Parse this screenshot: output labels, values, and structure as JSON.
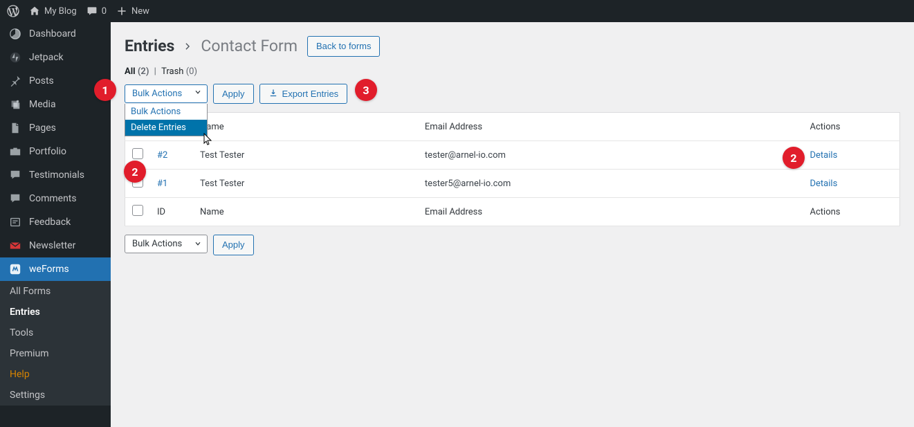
{
  "topbar": {
    "site_name": "My Blog",
    "comments_count": "0",
    "new_label": "New"
  },
  "sidebar": {
    "items": [
      {
        "label": "Dashboard",
        "icon": "dashboard"
      },
      {
        "label": "Jetpack",
        "icon": "jetpack"
      },
      {
        "label": "Posts",
        "icon": "posts"
      },
      {
        "label": "Media",
        "icon": "media"
      },
      {
        "label": "Pages",
        "icon": "pages"
      },
      {
        "label": "Portfolio",
        "icon": "portfolio"
      },
      {
        "label": "Testimonials",
        "icon": "testimonial"
      },
      {
        "label": "Comments",
        "icon": "comments"
      },
      {
        "label": "Feedback",
        "icon": "feedback"
      },
      {
        "label": "Newsletter",
        "icon": "newsletter"
      },
      {
        "label": "weForms",
        "icon": "weforms"
      }
    ],
    "submenu": [
      {
        "label": "All Forms"
      },
      {
        "label": "Entries",
        "current": true
      },
      {
        "label": "Tools"
      },
      {
        "label": "Premium"
      },
      {
        "label": "Help",
        "help": true
      },
      {
        "label": "Settings"
      }
    ]
  },
  "header": {
    "entries_label": "Entries",
    "form_name": "Contact Form",
    "back_label": "Back to forms"
  },
  "filters": {
    "all_label": "All",
    "all_count": "(2)",
    "trash_label": "Trash",
    "trash_count": "(0)"
  },
  "actions": {
    "bulk_label": "Bulk Actions",
    "apply_label": "Apply",
    "export_label": "Export Entries",
    "options": [
      {
        "label": "Bulk Actions"
      },
      {
        "label": "Delete Entries",
        "highlight": true
      }
    ]
  },
  "table": {
    "headers": {
      "id": "ID",
      "name": "Name",
      "email": "Email Address",
      "actions": "Actions"
    },
    "rows": [
      {
        "id": "#2",
        "name": "Test Tester",
        "email": "tester@arnel-io.com",
        "details": "Details"
      },
      {
        "id": "#1",
        "name": "Test Tester",
        "email": "tester5@arnel-io.com",
        "details": "Details"
      }
    ]
  },
  "annotations": {
    "1": "1",
    "2": "2",
    "3": "3"
  }
}
